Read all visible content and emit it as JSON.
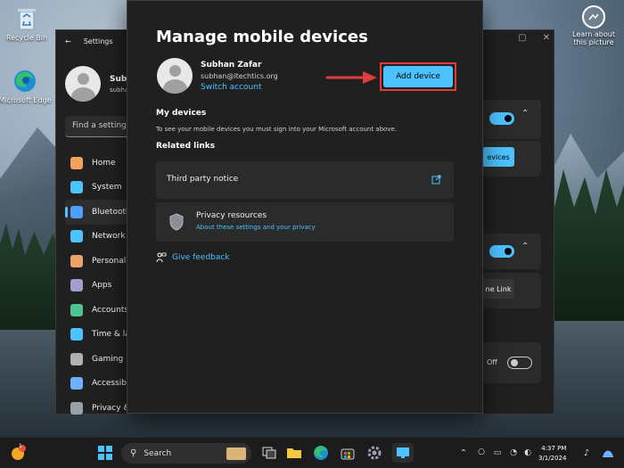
{
  "desktop": {
    "icons": [
      {
        "label": "Recycle Bin",
        "icon": "recycle-bin-icon"
      },
      {
        "label": "Microsoft Edge",
        "icon": "edge-icon"
      },
      {
        "label": "Learn about this picture",
        "icon": "camera-icon"
      }
    ]
  },
  "settings_window": {
    "title": "Settings",
    "user": {
      "name": "Subh",
      "email": "subha"
    },
    "search_placeholder": "Find a setting",
    "nav": [
      {
        "label": "Home",
        "icon": "home-icon",
        "color": "#f2a25c"
      },
      {
        "label": "System",
        "icon": "monitor-icon",
        "color": "#4cc2ff"
      },
      {
        "label": "Bluetooth",
        "icon": "bluetooth-icon",
        "color": "#4c9fff"
      },
      {
        "label": "Network &",
        "icon": "wifi-icon",
        "color": "#4cc2ff"
      },
      {
        "label": "Personaliz",
        "icon": "brush-icon",
        "color": "#e8a36b"
      },
      {
        "label": "Apps",
        "icon": "apps-icon",
        "color": "#a0a0d0"
      },
      {
        "label": "Accounts",
        "icon": "person-icon",
        "color": "#4dc48f"
      },
      {
        "label": "Time & la",
        "icon": "clock-icon",
        "color": "#4cc2ff"
      },
      {
        "label": "Gaming",
        "icon": "gamepad-icon",
        "color": "#b0b0b0"
      },
      {
        "label": "Accessibil",
        "icon": "accessibility-icon",
        "color": "#6cb0ff"
      },
      {
        "label": "Privacy &",
        "icon": "shield-icon",
        "color": "#9aa0a8"
      }
    ],
    "right_panel": {
      "devices_button": "evices",
      "phone_link_button": "ne Link",
      "toggle_off_label": "Off"
    }
  },
  "dialog": {
    "title": "Manage mobile devices",
    "user": {
      "name": "Subhan Zafar",
      "email": "subhan@itechtics.org",
      "switch_account": "Switch account"
    },
    "add_device_label": "Add device",
    "my_devices_heading": "My devices",
    "my_devices_text": "To see your mobile devices you must sign into your Microsoft account above.",
    "related_links_heading": "Related links",
    "third_party_notice": "Third party notice",
    "privacy_resources": "Privacy resources",
    "privacy_link": "About these settings and your privacy",
    "give_feedback": "Give feedback"
  },
  "taskbar": {
    "search_label": "Search",
    "time": "4:37 PM",
    "date": "3/1/2024",
    "notification_badge": "1"
  },
  "colors": {
    "accent": "#4cc2ff",
    "highlight_frame": "#e23b3b",
    "arrow": "#e23b3b"
  }
}
